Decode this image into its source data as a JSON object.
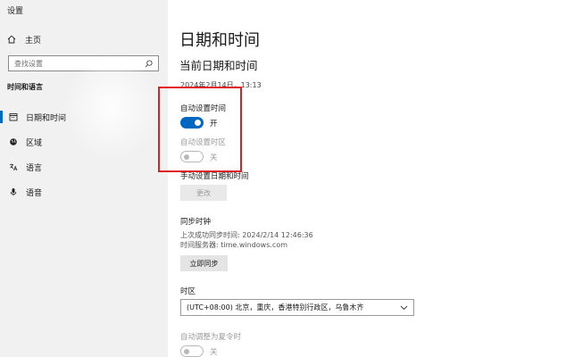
{
  "window": {
    "title": "设置"
  },
  "sidebar": {
    "home_label": "主页",
    "search_placeholder": "查找设置",
    "section_label": "时间和语言",
    "items": [
      {
        "label": "日期和时间",
        "icon": "calendar-icon",
        "active": true
      },
      {
        "label": "区域",
        "icon": "globe-icon",
        "active": false
      },
      {
        "label": "语言",
        "icon": "language-icon",
        "active": false
      },
      {
        "label": "语音",
        "icon": "microphone-icon",
        "active": false
      }
    ]
  },
  "main": {
    "page_title": "日期和时间",
    "section_title": "当前日期和时间",
    "current_datetime": "2024年2月14日，13:13",
    "auto_time": {
      "label": "自动设置时间",
      "state": "开"
    },
    "auto_timezone": {
      "label": "自动设置时区",
      "state": "关"
    },
    "manual": {
      "label": "手动设置日期和时间",
      "button": "更改"
    },
    "sync": {
      "title": "同步时钟",
      "last_sync": "上次成功同步时间: 2024/2/14 12:46:36",
      "server": "时间服务器: time.windows.com",
      "button": "立即同步"
    },
    "timezone": {
      "label": "时区",
      "value": "(UTC+08:00) 北京，重庆，香港特别行政区，乌鲁木齐"
    },
    "dst": {
      "label": "自动调整为夏令时",
      "state": "关"
    }
  },
  "colors": {
    "accent": "#0067c0",
    "highlight": "#e02020",
    "sidebar_bg": "#f1f1f1"
  }
}
